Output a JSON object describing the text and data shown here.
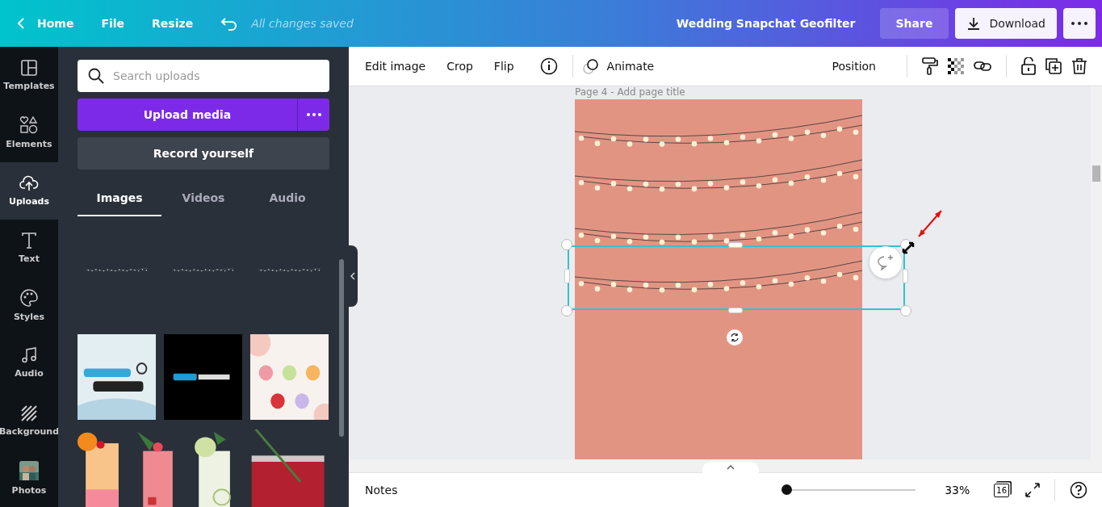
{
  "topbar": {
    "back_label": "Home",
    "menu": [
      "File",
      "Resize"
    ],
    "save_status": "All changes saved",
    "title": "Wedding Snapchat Geofilter",
    "share": "Share",
    "download": "Download"
  },
  "rail": [
    {
      "label": "Templates",
      "selected": false
    },
    {
      "label": "Elements",
      "selected": false
    },
    {
      "label": "Uploads",
      "selected": true
    },
    {
      "label": "Text",
      "selected": false
    },
    {
      "label": "Styles",
      "selected": false
    },
    {
      "label": "Audio",
      "selected": false
    },
    {
      "label": "Background",
      "selected": false
    },
    {
      "label": "Photos",
      "selected": false
    }
  ],
  "panel": {
    "search": {
      "placeholder": "Search uploads"
    },
    "upload_button": "Upload media",
    "record_button": "Record yourself",
    "tabs": [
      {
        "label": "Images",
        "selected": true
      },
      {
        "label": "Videos",
        "selected": false
      },
      {
        "label": "Audio",
        "selected": false
      }
    ],
    "thumbnails": [
      {
        "kind": "lights"
      },
      {
        "kind": "lights"
      },
      {
        "kind": "lights"
      },
      {
        "kind": "picture"
      },
      {
        "kind": "picture"
      },
      {
        "kind": "picture"
      }
    ],
    "drinks": [
      {
        "kind": "picture"
      },
      {
        "kind": "picture"
      },
      {
        "kind": "picture"
      },
      {
        "kind": "picture"
      }
    ]
  },
  "toolbar": {
    "left": [
      "Edit image",
      "Crop",
      "Flip"
    ],
    "animate": "Animate",
    "position": "Position"
  },
  "canvas": {
    "page_title": "Page 4 - Add page title"
  },
  "footer": {
    "notes": "Notes",
    "zoom": {
      "level": 0,
      "reading": "33%"
    },
    "page_count": "16"
  }
}
